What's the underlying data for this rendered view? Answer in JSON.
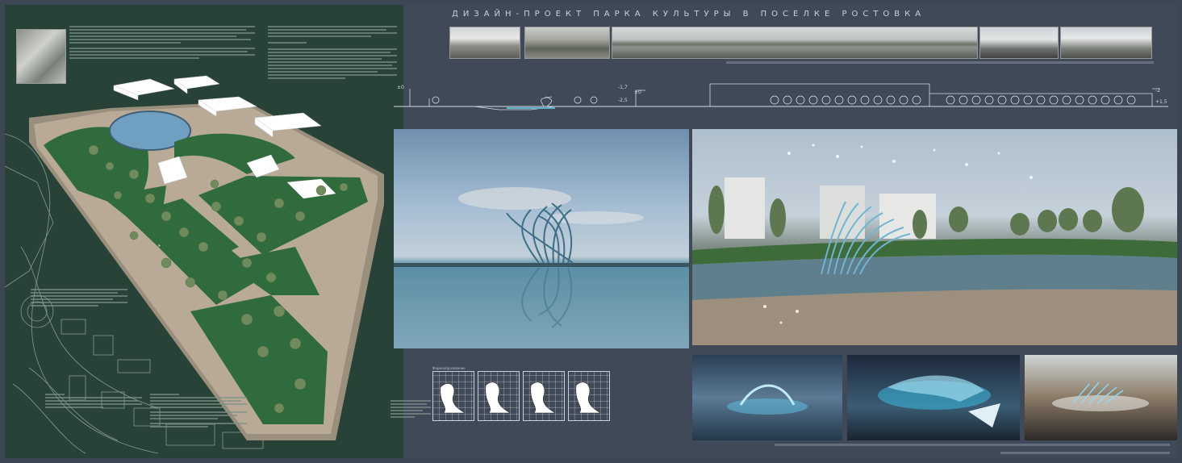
{
  "title": "ДИЗАЙН-ПРОЕКТ ПАРКА КУЛЬТУРЫ В ПОСЕЛКЕ РОСТОВКА",
  "sketch_label": "Формообразование",
  "colors": {
    "left_panel": "#284238",
    "right_panel": "#3f4957",
    "lawn": "#2f6b3c",
    "path": "#b8aa96",
    "water": "#6f9fc1"
  },
  "section_marks": [
    "±0",
    "-1,7",
    "-2,5",
    "±0",
    "-2",
    "+1,5"
  ]
}
